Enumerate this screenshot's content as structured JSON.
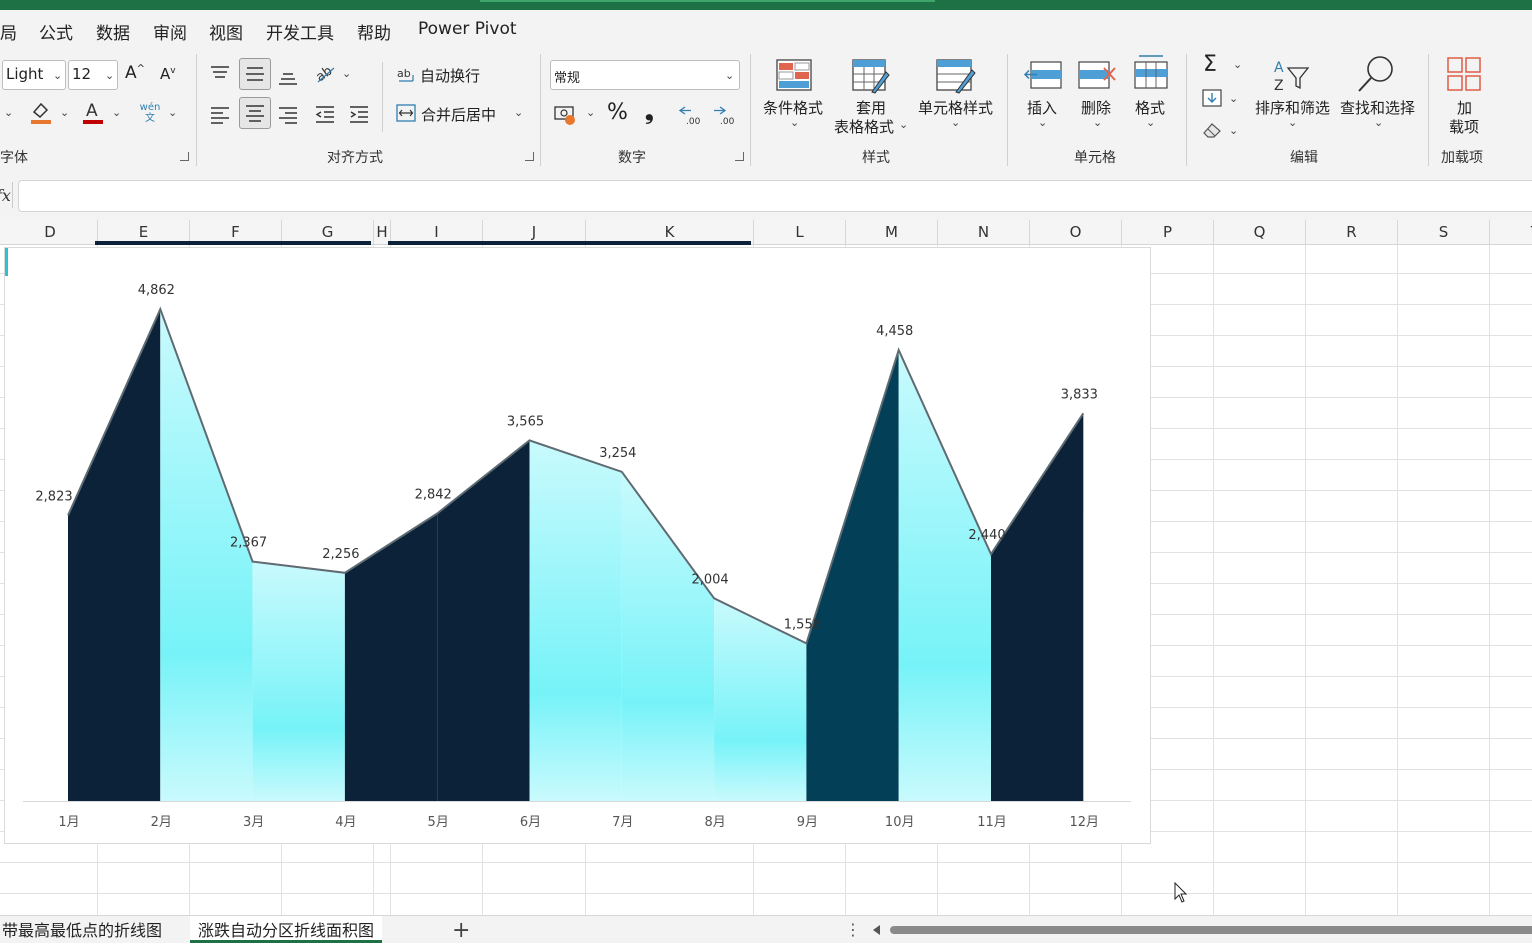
{
  "menu": {
    "items": [
      {
        "label": "局"
      },
      {
        "label": "公式"
      },
      {
        "label": "数据"
      },
      {
        "label": "审阅"
      },
      {
        "label": "视图"
      },
      {
        "label": "开发工具"
      },
      {
        "label": "帮助"
      },
      {
        "label": "Power Pivot"
      }
    ]
  },
  "ribbon": {
    "font": {
      "font_name": "Light",
      "font_size": "12",
      "phonetic_label": "wén 文",
      "group_label": "字体",
      "visible_group_label": "字体"
    },
    "alignment": {
      "wrap_text": "自动换行",
      "merge_center": "合并后居中",
      "group_label": "对齐方式"
    },
    "number": {
      "format_value": "常规",
      "percent_symbol": "%",
      "comma_symbol": "❟",
      "group_label": "数字"
    },
    "styles": {
      "conditional": "条件格式",
      "table_line1": "套用",
      "table_line2": "表格格式",
      "cell_styles": "单元格样式",
      "group_label": "样式"
    },
    "cells": {
      "insert": "插入",
      "delete": "删除",
      "format": "格式",
      "group_label": "单元格"
    },
    "editing": {
      "sort_filter": "排序和筛选",
      "find_select": "查找和选择",
      "group_label": "编辑"
    },
    "addins": {
      "line1": "加",
      "line2": "载项",
      "group_label": "加载项"
    }
  },
  "formula_bar": {
    "fx_label": "fx",
    "value": ""
  },
  "columns": [
    "D",
    "E",
    "F",
    "G",
    "H",
    "I",
    "J",
    "K",
    "L",
    "M",
    "N",
    "O",
    "P",
    "Q",
    "R",
    "S",
    "T"
  ],
  "chart_data": {
    "type": "area",
    "categories": [
      "1月",
      "2月",
      "3月",
      "4月",
      "5月",
      "6月",
      "7月",
      "8月",
      "9月",
      "10月",
      "11月",
      "12月"
    ],
    "values": [
      2823,
      4862,
      2367,
      2256,
      2842,
      3565,
      3254,
      2004,
      1558,
      4458,
      2440,
      3833
    ],
    "data_labels": [
      "2,823",
      "4,862",
      "2,367",
      "2,256",
      "2,842",
      "3,565",
      "3,254",
      "2,004",
      "1,558",
      "4,458",
      "2,440",
      "3,833"
    ],
    "segment_trend": [
      "up",
      "down",
      "down",
      "up",
      "up",
      "down",
      "down",
      "down",
      "up",
      "down",
      "up"
    ],
    "colors": {
      "rising": "#0b2239",
      "rising_alt": "#033f57",
      "falling_top": "#c9fafd",
      "falling_mid": "#76f3f8",
      "line": "#5f6b72"
    },
    "ylim": [
      0,
      5200
    ],
    "legend": "none",
    "grid": false
  },
  "sheet_tabs": [
    {
      "label": "带最高最低点的折线图"
    },
    {
      "label": "涨跌自动分区折线面积图",
      "active": true
    }
  ],
  "tab_add_label": "+",
  "tab_more_label": "⋮"
}
